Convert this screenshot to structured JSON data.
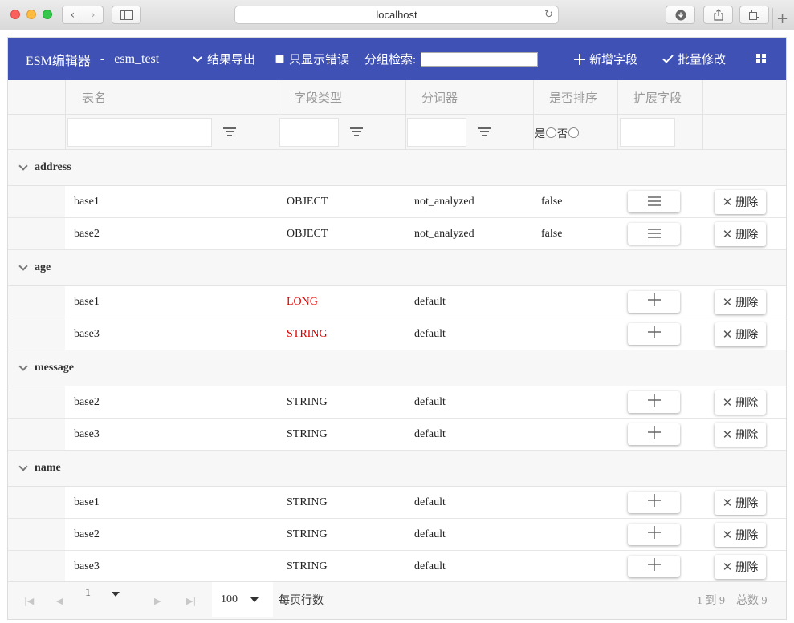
{
  "browser": {
    "url": "localhost"
  },
  "header": {
    "app_name": "ESM编辑器",
    "separator": "-",
    "db_name": "esm_test",
    "export_label": "结果导出",
    "only_errors_label": "只显示错误",
    "group_search_label": "分组检索:",
    "group_search_value": "",
    "add_field_label": "新增字段",
    "batch_edit_label": "批量修改"
  },
  "columns": {
    "table_name": "表名",
    "field_type": "字段类型",
    "analyzer": "分词器",
    "sortable": "是否排序",
    "extension": "扩展字段"
  },
  "filters": {
    "yes": "是",
    "no": "否"
  },
  "delete_label": "删除",
  "groups": [
    {
      "name": "address",
      "rows": [
        {
          "table": "base1",
          "type": "OBJECT",
          "analyzer": "not_analyzed",
          "sortable": "false",
          "ext_icon": "menu-icon",
          "error": false
        },
        {
          "table": "base2",
          "type": "OBJECT",
          "analyzer": "not_analyzed",
          "sortable": "false",
          "ext_icon": "menu-icon",
          "error": false
        }
      ]
    },
    {
      "name": "age",
      "rows": [
        {
          "table": "base1",
          "type": "LONG",
          "analyzer": "default",
          "sortable": "",
          "ext_icon": "plus-icon",
          "error": true
        },
        {
          "table": "base3",
          "type": "STRING",
          "analyzer": "default",
          "sortable": "",
          "ext_icon": "plus-icon",
          "error": true
        }
      ]
    },
    {
      "name": "message",
      "rows": [
        {
          "table": "base2",
          "type": "STRING",
          "analyzer": "default",
          "sortable": "",
          "ext_icon": "plus-icon",
          "error": false
        },
        {
          "table": "base3",
          "type": "STRING",
          "analyzer": "default",
          "sortable": "",
          "ext_icon": "plus-icon",
          "error": false
        }
      ]
    },
    {
      "name": "name",
      "rows": [
        {
          "table": "base1",
          "type": "STRING",
          "analyzer": "default",
          "sortable": "",
          "ext_icon": "plus-icon",
          "error": false
        },
        {
          "table": "base2",
          "type": "STRING",
          "analyzer": "default",
          "sortable": "",
          "ext_icon": "plus-icon",
          "error": false
        },
        {
          "table": "base3",
          "type": "STRING",
          "analyzer": "default",
          "sortable": "",
          "ext_icon": "plus-icon",
          "error": false
        }
      ]
    }
  ],
  "pager": {
    "page": "1",
    "page_size": "100",
    "rows_per_page_label": "每页行数",
    "range": "1 到 9",
    "total": "总数 9"
  },
  "colors": {
    "header": "#3f51b5",
    "error_text": "#e00000"
  }
}
